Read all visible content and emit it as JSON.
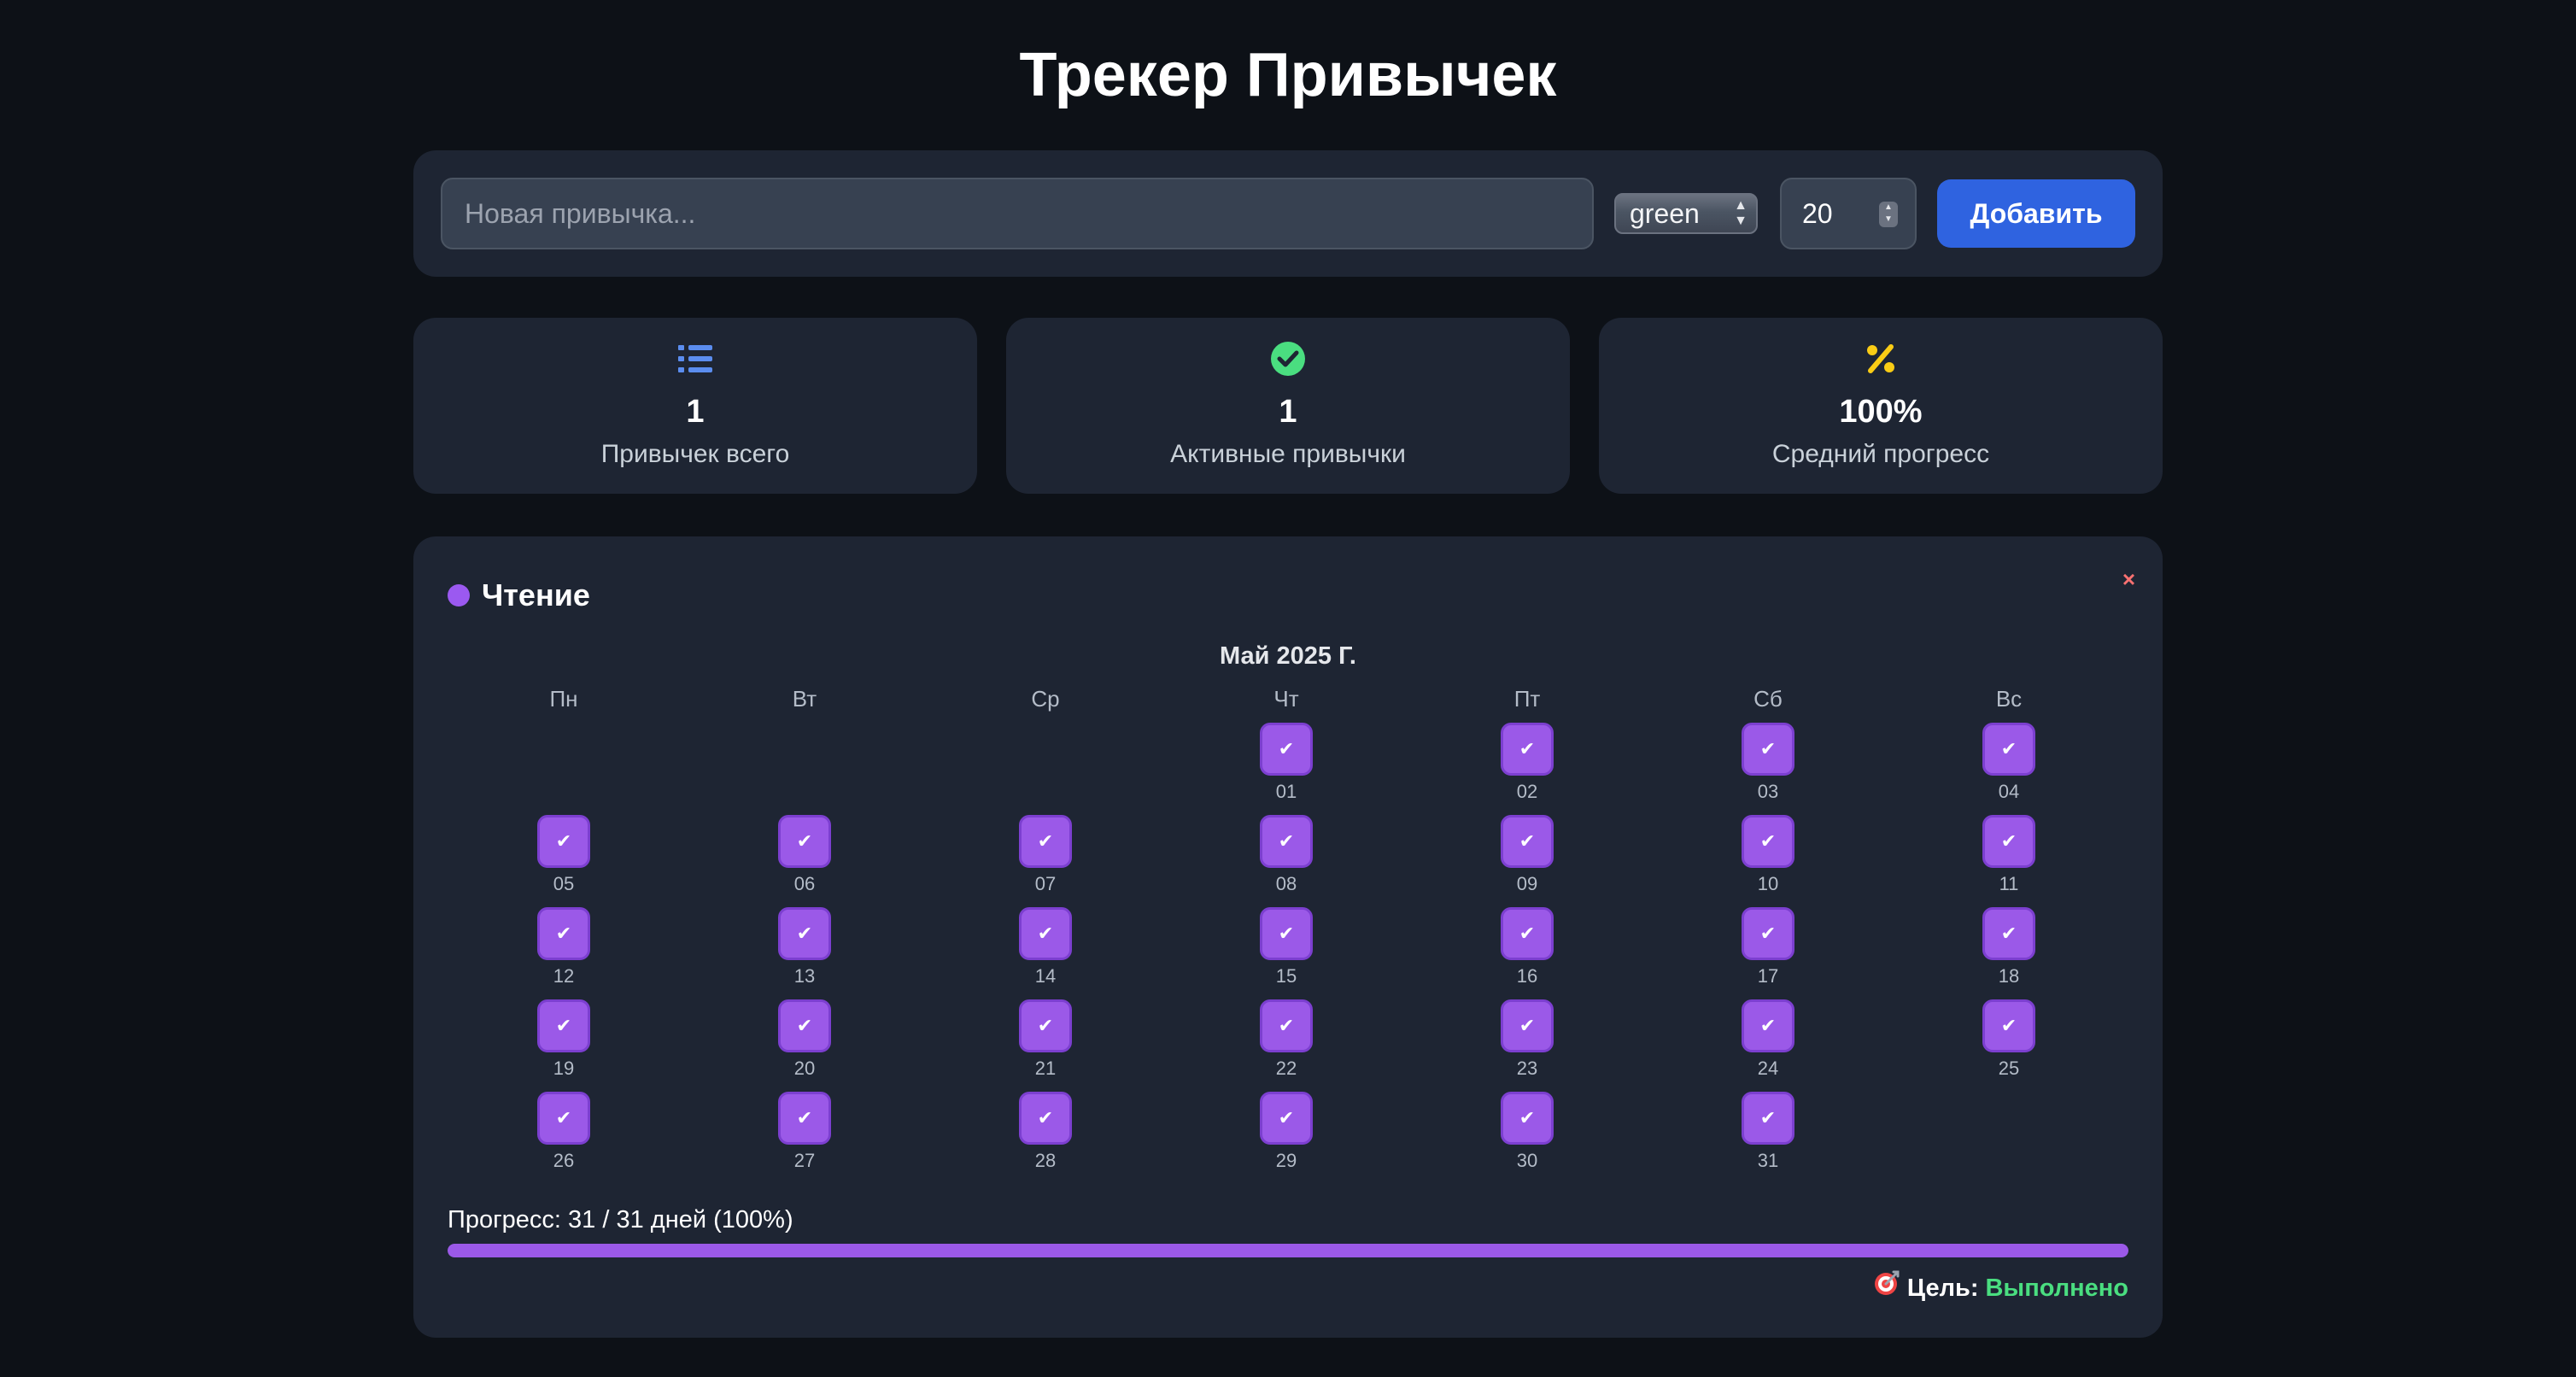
{
  "app": {
    "title": "Трекер Привычек"
  },
  "form": {
    "habit_placeholder": "Новая привычка...",
    "color_value": "green",
    "goal_value": "20",
    "add_label": "Добавить"
  },
  "stats": [
    {
      "icon": "list-icon",
      "value": "1",
      "label": "Привычек всего",
      "color": "#5b8def"
    },
    {
      "icon": "check-circle-icon",
      "value": "1",
      "label": "Активные привычки",
      "color": "#4ade80"
    },
    {
      "icon": "percent-icon",
      "value": "100%",
      "label": "Средний прогресс",
      "color": "#facc15"
    }
  ],
  "habit": {
    "name": "Чтение",
    "color": "#9b59e8",
    "delete_label": "×",
    "month": "Май 2025 Г.",
    "weekdays": [
      "Пн",
      "Вт",
      "Ср",
      "Чт",
      "Пт",
      "Сб",
      "Вс"
    ],
    "first_weekday_index": 3,
    "check_mark": "✔",
    "days": [
      "01",
      "02",
      "03",
      "04",
      "05",
      "06",
      "07",
      "08",
      "09",
      "10",
      "11",
      "12",
      "13",
      "14",
      "15",
      "16",
      "17",
      "18",
      "19",
      "20",
      "21",
      "22",
      "23",
      "24",
      "25",
      "26",
      "27",
      "28",
      "29",
      "30",
      "31"
    ],
    "completed_days": 31,
    "total_days": 31,
    "progress_text": "Прогресс: 31 / 31 дней (100%)",
    "progress_fraction": 1.0,
    "goal_label": "Цель:",
    "goal_status": "Выполнено",
    "goal_icon": "target-icon"
  },
  "colors": {
    "background": "#0d1117",
    "panel": "#1e2533",
    "accent_blue": "#2f63e0",
    "success": "#4ade80"
  }
}
